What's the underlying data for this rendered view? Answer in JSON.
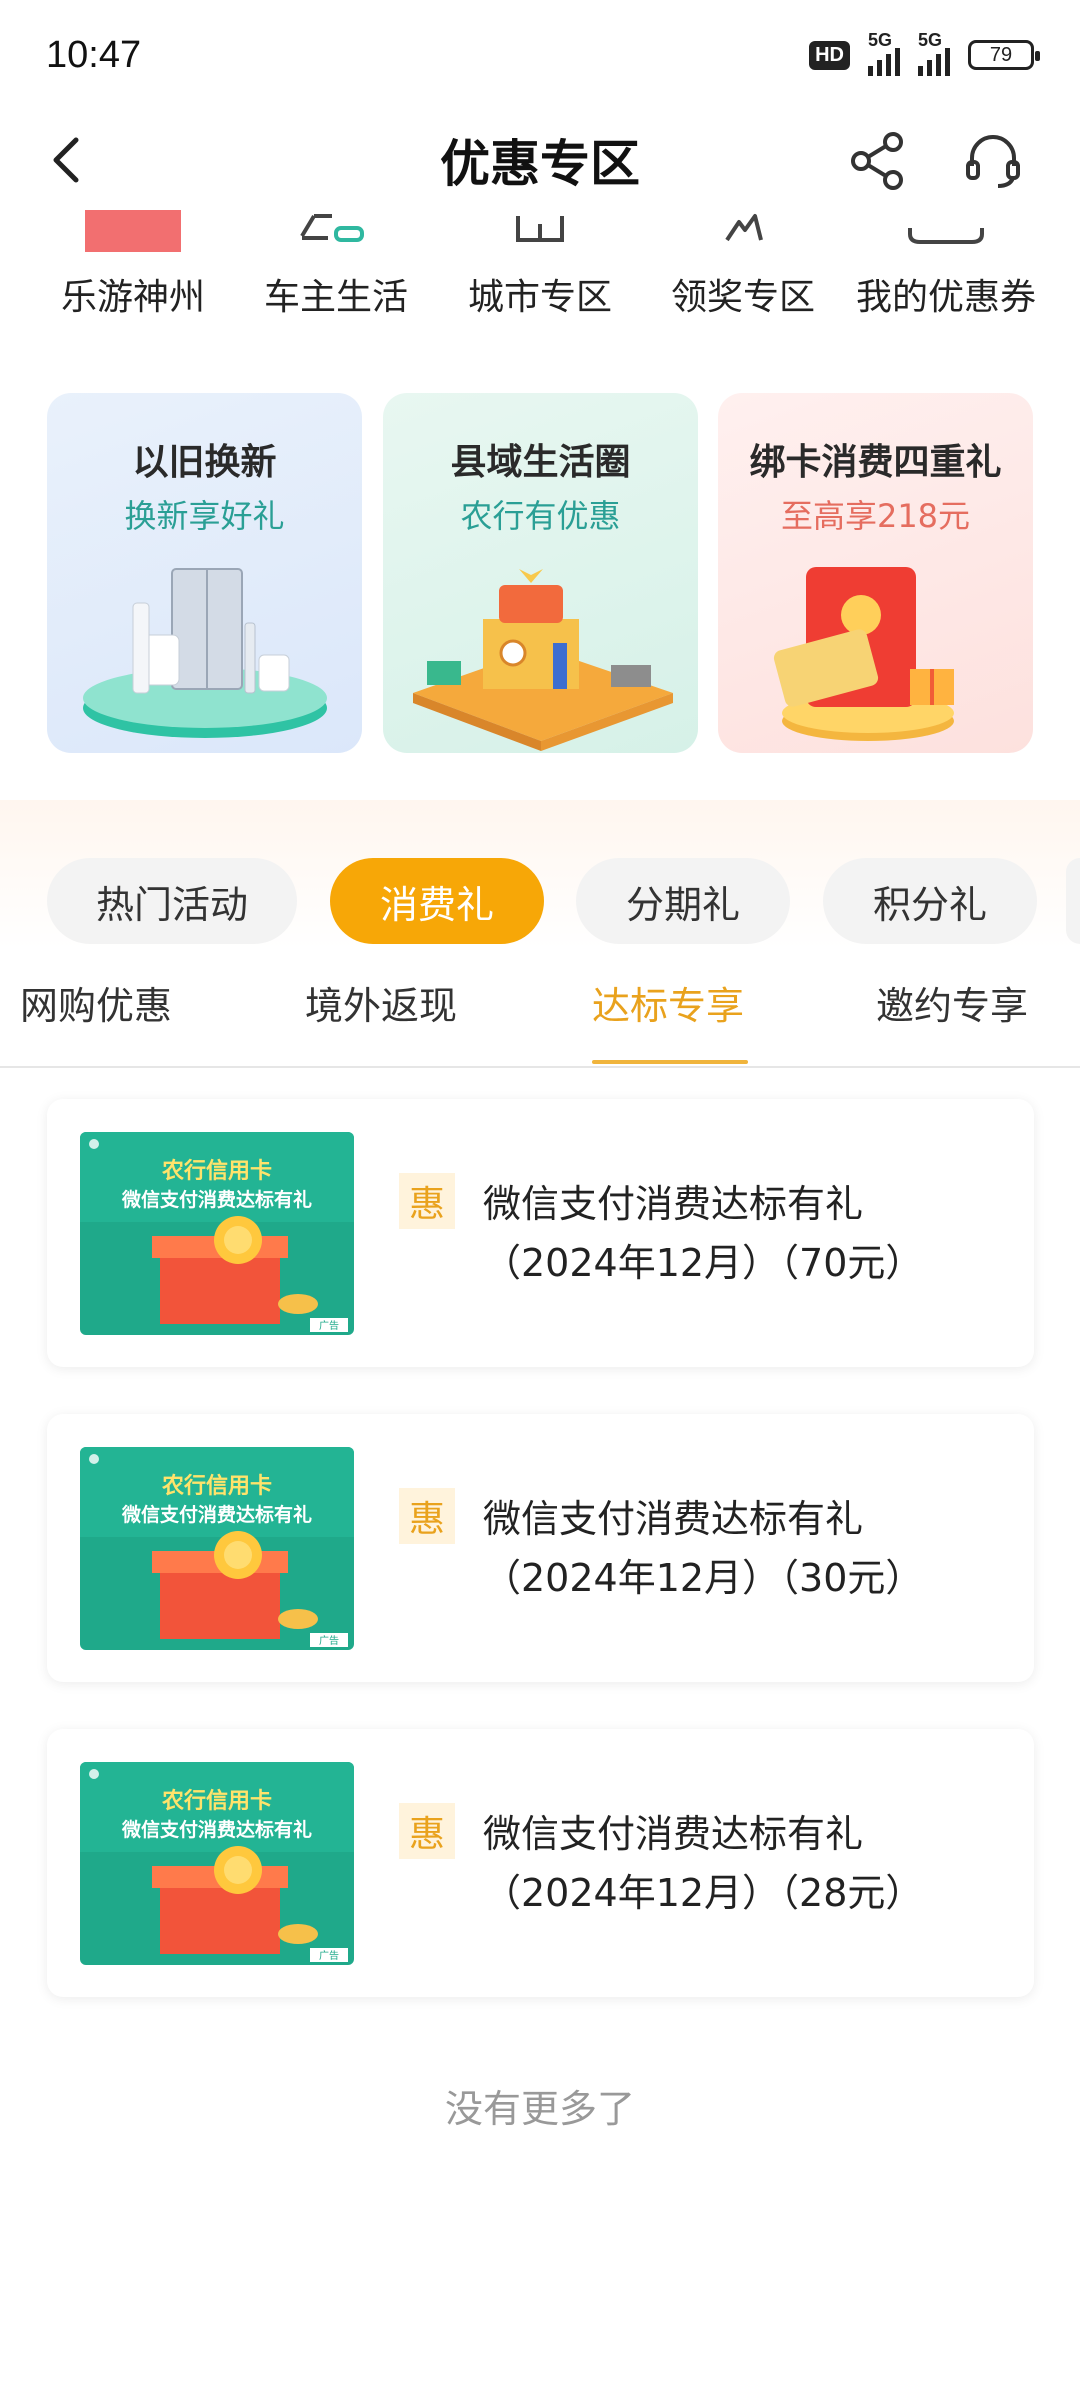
{
  "status_bar": {
    "time": "10:47",
    "hd": "HD",
    "net1": "5G",
    "net2": "5G",
    "battery": "79"
  },
  "header": {
    "title": "优惠专区",
    "back_icon": "chevron-left-icon",
    "share_icon": "share-icon",
    "service_icon": "headset-icon"
  },
  "categories": [
    {
      "label": "乐游神州",
      "icon": "travel-icon"
    },
    {
      "label": "车主生活",
      "icon": "car-icon"
    },
    {
      "label": "城市专区",
      "icon": "city-icon"
    },
    {
      "label": "领奖专区",
      "icon": "prize-icon"
    },
    {
      "label": "我的优惠券",
      "icon": "coupon-icon"
    }
  ],
  "promos": [
    {
      "title": "以旧换新",
      "subtitle": "换新享好礼",
      "subtitle_color": "#2a9f95"
    },
    {
      "title": "县域生活圈",
      "subtitle": "农行有优惠",
      "subtitle_color": "#2a9f95"
    },
    {
      "title": "绑卡消费四重礼",
      "subtitle": "至高享218元",
      "subtitle_color": "#e56d5f"
    }
  ],
  "pill_tabs": [
    {
      "label": "热门活动",
      "active": false
    },
    {
      "label": "消费礼",
      "active": true
    },
    {
      "label": "分期礼",
      "active": false
    },
    {
      "label": "积分礼",
      "active": false
    }
  ],
  "sub_tabs": [
    {
      "label": "网购优惠",
      "active": false
    },
    {
      "label": "境外返现",
      "active": false
    },
    {
      "label": "达标专享",
      "active": true
    },
    {
      "label": "邀约专享",
      "active": false
    }
  ],
  "offers": [
    {
      "tag": "惠",
      "title": "微信支付消费达标有礼",
      "subtitle": "（2024年12月）（70元）",
      "thumb_title": "农行信用卡",
      "thumb_sub": "微信支付消费达标有礼",
      "thumb_ad": "广告"
    },
    {
      "tag": "惠",
      "title": "微信支付消费达标有礼",
      "subtitle": "（2024年12月）（30元）",
      "thumb_title": "农行信用卡",
      "thumb_sub": "微信支付消费达标有礼",
      "thumb_ad": "广告"
    },
    {
      "tag": "惠",
      "title": "微信支付消费达标有礼",
      "subtitle": "（2024年12月）（28元）",
      "thumb_title": "农行信用卡",
      "thumb_sub": "微信支付消费达标有礼",
      "thumb_ad": "广告"
    }
  ],
  "footer": {
    "no_more": "没有更多了"
  },
  "colors": {
    "accent": "#f7a707",
    "tab_active": "#e9a21d",
    "thumb_green": "#1fa98a"
  }
}
